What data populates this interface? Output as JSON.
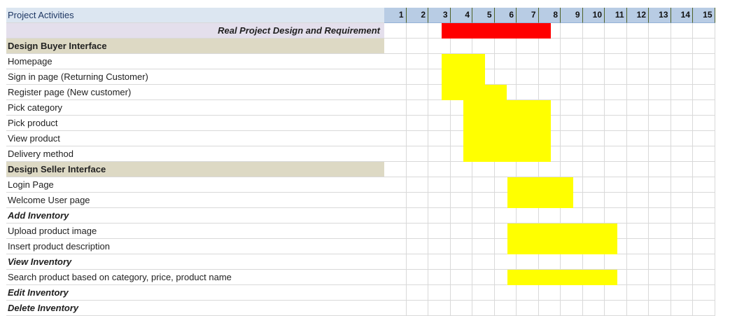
{
  "sheet": {
    "header_label": "Project  Activities",
    "days": [
      "1",
      "2",
      "3",
      "4",
      "5",
      "6",
      "7",
      "8",
      "9",
      "10",
      "11",
      "12",
      "13",
      "14",
      "15"
    ]
  },
  "colors": {
    "header_fill": "#b8cce4",
    "section_fill": "#ddd9c4",
    "milestone_fill": "#e4dfec",
    "bar_red": "#ff0000",
    "bar_yellow": "#ffff00"
  },
  "rows": [
    {
      "label": "Real Project Design and Requirement",
      "style": "milestone",
      "bar": {
        "start": 3,
        "end": 7,
        "color": "red"
      }
    },
    {
      "label": "Design Buyer Interface",
      "style": "section"
    },
    {
      "label": "Homepage",
      "style": "task",
      "bar": {
        "start": 3,
        "end": 4,
        "color": "yellow"
      }
    },
    {
      "label": "Sign in page (Returning Customer)",
      "style": "task",
      "bar": {
        "start": 3,
        "end": 4,
        "color": "yellow"
      }
    },
    {
      "label": "Register page (New customer)",
      "style": "task",
      "bar": {
        "start": 3,
        "end": 5,
        "color": "yellow"
      }
    },
    {
      "label": "Pick category",
      "style": "task",
      "bar": {
        "start": 4,
        "end": 7,
        "color": "yellow"
      }
    },
    {
      "label": "Pick product",
      "style": "task",
      "bar": {
        "start": 4,
        "end": 7,
        "color": "yellow"
      }
    },
    {
      "label": "View product",
      "style": "task",
      "bar": {
        "start": 4,
        "end": 7,
        "color": "yellow"
      }
    },
    {
      "label": "Delivery method",
      "style": "task",
      "bar": {
        "start": 4,
        "end": 7,
        "color": "yellow"
      }
    },
    {
      "label": "Design Seller Interface",
      "style": "section"
    },
    {
      "label": "Login Page",
      "style": "task",
      "bar": {
        "start": 6,
        "end": 8,
        "color": "yellow"
      }
    },
    {
      "label": "Welcome User page",
      "style": "task",
      "bar": {
        "start": 6,
        "end": 8,
        "color": "yellow"
      }
    },
    {
      "label": "Add Inventory",
      "style": "subsection"
    },
    {
      "label": "Upload product image",
      "style": "task",
      "bar": {
        "start": 6,
        "end": 10,
        "color": "yellow"
      }
    },
    {
      "label": "Insert product  description",
      "style": "task",
      "bar": {
        "start": 6,
        "end": 10,
        "color": "yellow"
      }
    },
    {
      "label": "View Inventory",
      "style": "subsection"
    },
    {
      "label": "Search product based on category, price, product  name",
      "style": "task",
      "bar": {
        "start": 6,
        "end": 10,
        "color": "yellow"
      }
    },
    {
      "label": "Edit Inventory",
      "style": "subsection"
    },
    {
      "label": "Delete Inventory",
      "style": "subsection"
    }
  ]
}
